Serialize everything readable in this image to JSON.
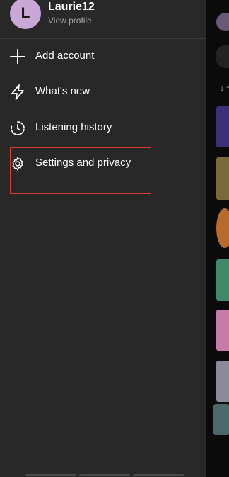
{
  "profile": {
    "avatar_letter": "L",
    "username": "Laurie12",
    "subtitle": "View profile"
  },
  "menu": [
    {
      "label": "Add account",
      "icon": "plus-icon"
    },
    {
      "label": "What's new",
      "icon": "lightning-icon"
    },
    {
      "label": "Listening history",
      "icon": "history-icon"
    },
    {
      "label": "Settings and privacy",
      "icon": "gear-icon"
    }
  ],
  "colors": {
    "drawer_bg": "#282828",
    "page_bg": "#121212",
    "avatar_bg": "#c9a8d8",
    "highlight": "#d93a3a",
    "secondary_text": "#a7a7a7"
  }
}
